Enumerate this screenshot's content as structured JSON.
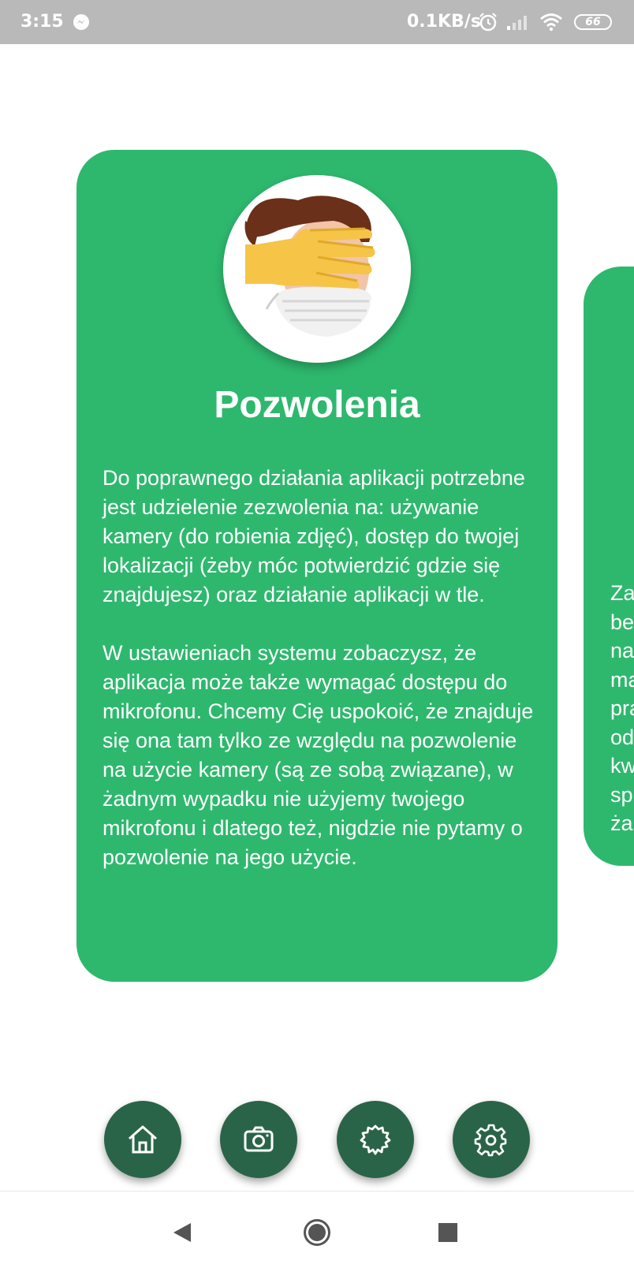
{
  "status_bar": {
    "time": "3:15",
    "speed": "0.1KB/s",
    "battery": "66",
    "icons": [
      "messenger-icon",
      "alarm-icon",
      "signal-icon",
      "wifi-icon",
      "battery-icon"
    ]
  },
  "card": {
    "image": "face-covered-by-hand-with-mask",
    "title": "Pozwolenia",
    "paragraph1": "Do poprawnego działania aplikacji potrzebne jest udzielenie zezwolenia na: używanie kamery (do robienia zdjęć), dostęp do twojej lokalizacji (żeby móc potwierdzić gdzie się znajdujesz) oraz działanie aplikacji w tle.",
    "paragraph2": "W ustawieniach systemu zobaczysz, że aplikacja może także wymagać dostępu do mikrofonu. Chcemy Cię uspokoić, że znajduje się ona tam tylko ze względu na pozwolenie na użycie kamery (są ze sobą związane), w żadnym wypadku nie użyjemy twojego mikrofonu i dlatego też, nigdzie nie pytamy o pozwolenie na jego użycie."
  },
  "next_card": {
    "text_fragment": "Za\nbe\nna\nma\npra\nod\nkw\nsp\nża"
  },
  "bottom_nav": {
    "buttons": [
      "home-icon",
      "camera-icon",
      "badge-icon",
      "settings-icon"
    ]
  },
  "system_nav": {
    "buttons": [
      "back",
      "home",
      "recents"
    ]
  },
  "colors": {
    "card": "#2eb86e",
    "fab": "#2a6448",
    "status_bar": "#b9b9b9"
  }
}
